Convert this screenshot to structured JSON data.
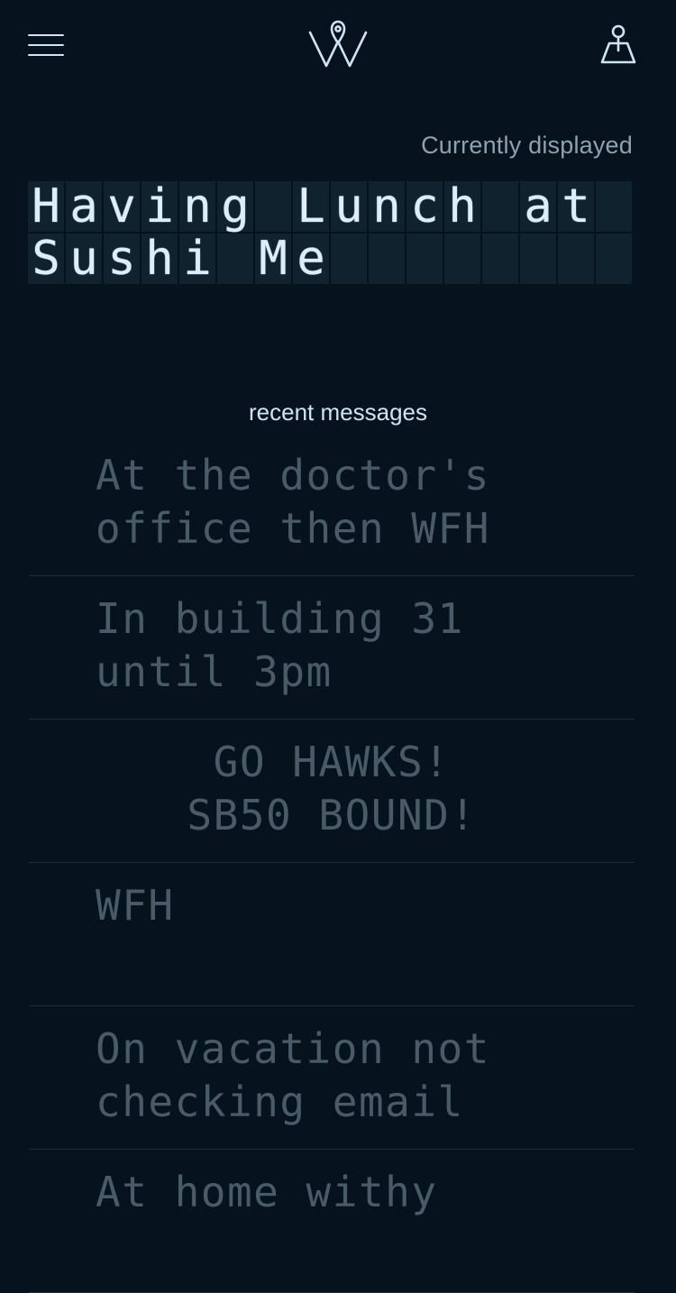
{
  "header": {
    "menu_icon": "hamburger-menu-icon",
    "logo_icon": "location-pin-w-logo",
    "map_icon": "map-pin-icon"
  },
  "current": {
    "label": "Currently displayed",
    "line1": "Having Lunch at",
    "line2": "Sushi Me"
  },
  "recent": {
    "label": "recent messages",
    "messages": [
      {
        "line1": "At the doctor's",
        "line2": "office then WFH"
      },
      {
        "line1": "In building 31",
        "line2": "until 3pm"
      },
      {
        "line1": "GO HAWKS!",
        "line2": "SB50 BOUND!"
      },
      {
        "line1": "WFH",
        "line2": ""
      },
      {
        "line1": "On vacation not",
        "line2": "checking email"
      },
      {
        "line1": "At home withy",
        "line2": ""
      }
    ]
  },
  "colors": {
    "background": "#06131f",
    "cell": "#11222f",
    "text": "#cfe3f2",
    "muted": "#4a5b68"
  }
}
